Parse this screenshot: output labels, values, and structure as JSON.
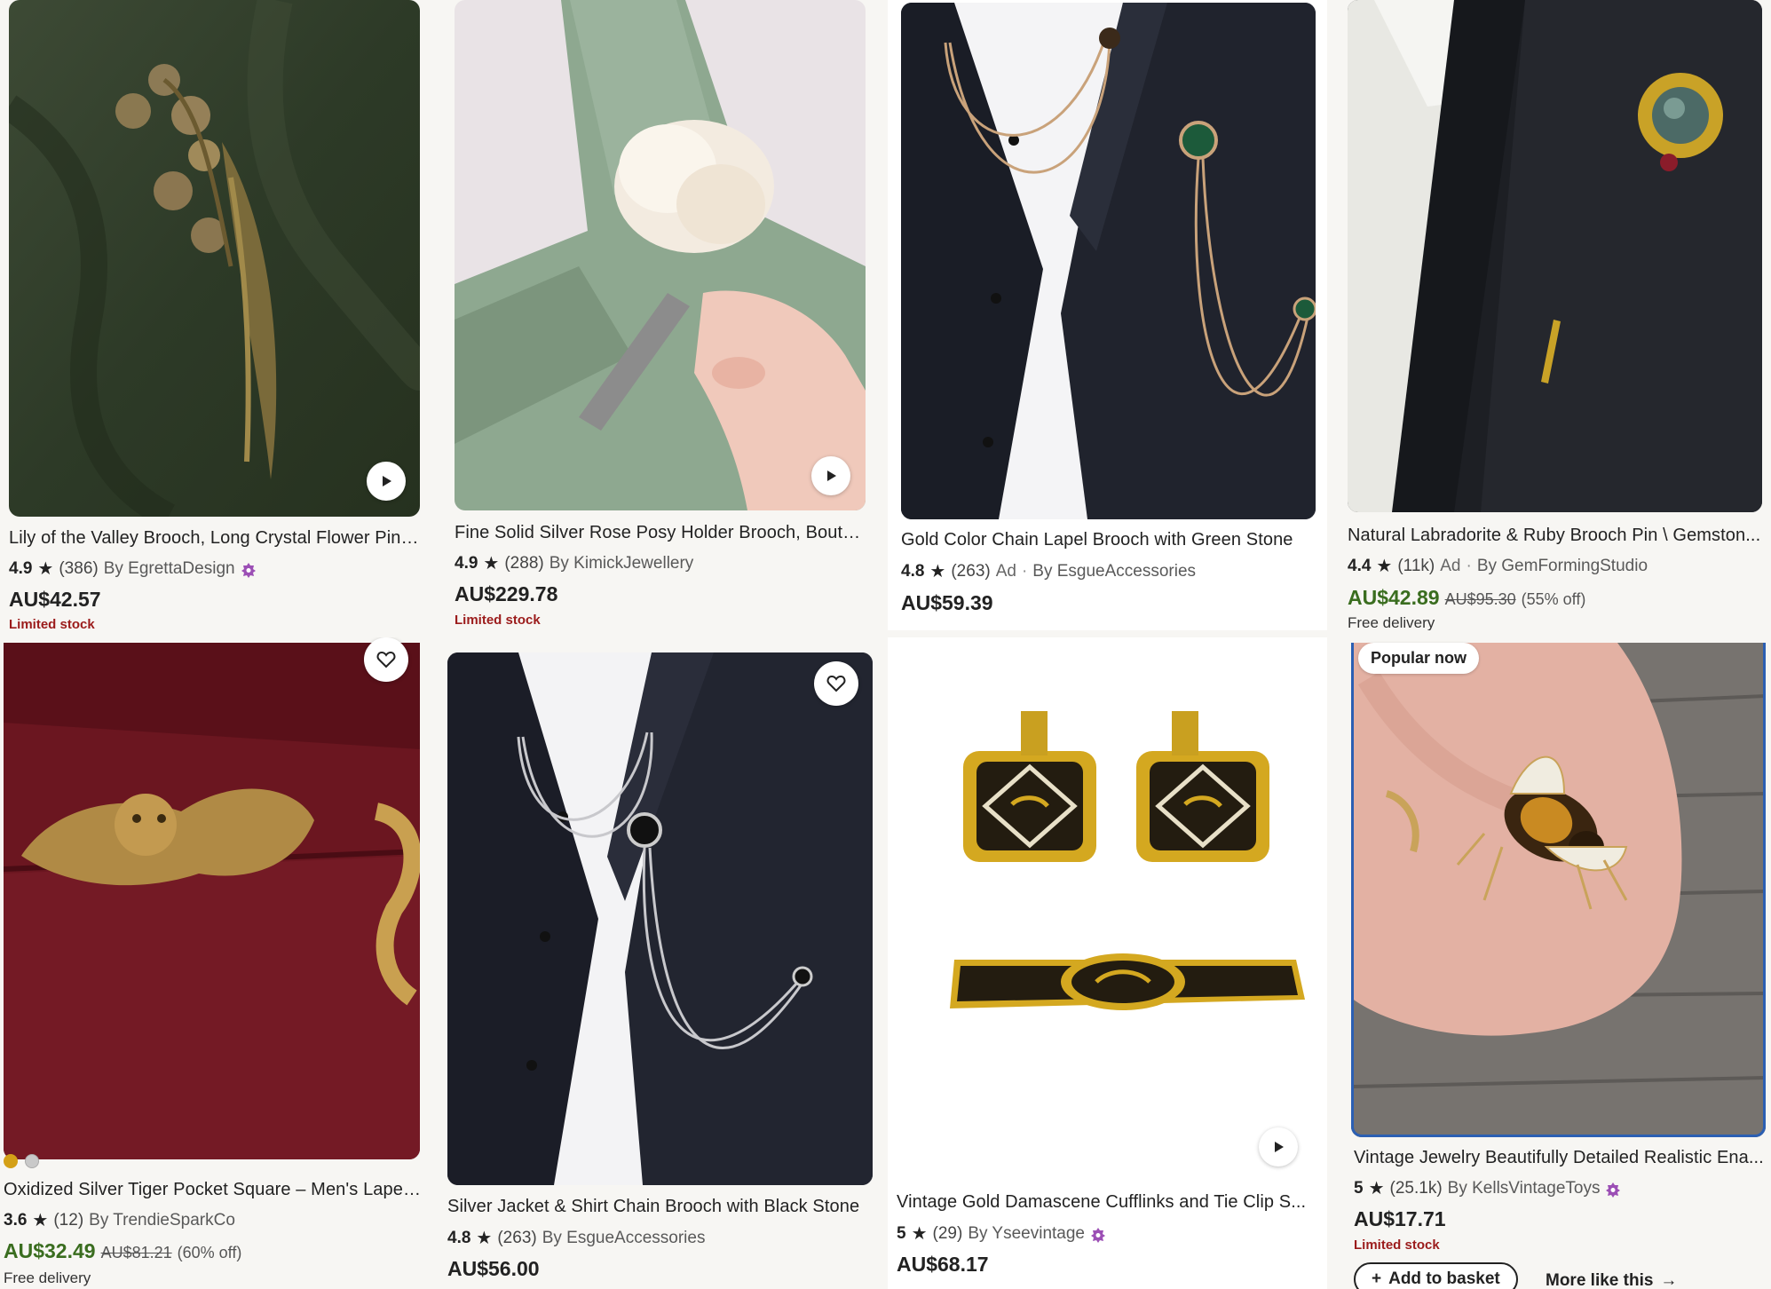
{
  "listings": [
    {
      "title": "Lily of the Valley Brooch, Long Crystal Flower Pin, ...",
      "rating": "4.9",
      "reviews": "(386)",
      "ad": "",
      "shop": "By EgrettaDesign",
      "star_seller": true,
      "price": "AU$42.57",
      "sale_price": "",
      "original_price": "",
      "discount": "",
      "note": "Limited stock",
      "delivery": "",
      "badge": "",
      "has_play": true,
      "has_fav": false
    },
    {
      "title": "Fine Solid Silver Rose Posy Holder Brooch, Bouton...",
      "rating": "4.9",
      "reviews": "(288)",
      "ad": "",
      "shop": "By KimickJewellery",
      "star_seller": false,
      "price": "AU$229.78",
      "sale_price": "",
      "original_price": "",
      "discount": "",
      "note": "Limited stock",
      "delivery": "",
      "badge": "",
      "has_play": true,
      "has_fav": false
    },
    {
      "title": "Gold Color Chain Lapel Brooch with Green Stone",
      "rating": "4.8",
      "reviews": "(263)",
      "ad": "Ad",
      "shop": "By EsgueAccessories",
      "star_seller": false,
      "price": "AU$59.39",
      "sale_price": "",
      "original_price": "",
      "discount": "",
      "note": "",
      "delivery": "",
      "badge": "",
      "has_play": false,
      "has_fav": false
    },
    {
      "title": "Natural Labradorite & Ruby Brooch Pin \\ Gemston...",
      "rating": "4.4",
      "reviews": "(11k)",
      "ad": "Ad",
      "shop": "By GemFormingStudio",
      "star_seller": false,
      "price": "",
      "sale_price": "AU$42.89",
      "original_price": "AU$95.30",
      "discount": "(55% off)",
      "note": "",
      "delivery": "Free delivery",
      "badge": "",
      "has_play": false,
      "has_fav": false
    },
    {
      "title": "Oxidized Silver Tiger Pocket Square – Men's Lapel...",
      "rating": "3.6",
      "reviews": "(12)",
      "ad": "",
      "shop": "By TrendieSparkCo",
      "star_seller": false,
      "price": "",
      "sale_price": "AU$32.49",
      "original_price": "AU$81.21",
      "discount": "(60% off)",
      "note": "",
      "delivery": "Free delivery",
      "badge": "",
      "has_play": false,
      "has_fav": true,
      "swatch_colors": [
        "#d4a017",
        "#c9c9c9"
      ]
    },
    {
      "title": "Silver Jacket & Shirt Chain Brooch with Black Stone",
      "rating": "4.8",
      "reviews": "(263)",
      "ad": "",
      "shop": "By EsgueAccessories",
      "star_seller": false,
      "price": "AU$56.00",
      "sale_price": "",
      "original_price": "",
      "discount": "",
      "note": "",
      "delivery": "",
      "badge": "",
      "has_play": false,
      "has_fav": true
    },
    {
      "title": "Vintage Gold Damascene Cufflinks and Tie Clip S...",
      "rating": "5",
      "reviews": "(29)",
      "ad": "",
      "shop": "By Yseevintage",
      "star_seller": true,
      "price": "AU$68.17",
      "sale_price": "",
      "original_price": "",
      "discount": "",
      "note": "",
      "delivery": "",
      "badge": "",
      "has_play": true,
      "has_fav": false
    },
    {
      "title": "Vintage Jewelry Beautifully Detailed Realistic Ena...",
      "rating": "5",
      "reviews": "(25.1k)",
      "ad": "",
      "shop": "By KellsVintageToys",
      "star_seller": true,
      "price": "AU$17.71",
      "sale_price": "",
      "original_price": "",
      "discount": "",
      "note": "Limited stock",
      "delivery": "",
      "badge": "Popular now",
      "has_play": false,
      "has_fav": false,
      "add_to_basket": "Add to basket",
      "more_like_this": "More like this"
    }
  ],
  "icons": {
    "star": "★",
    "plus": "+",
    "arrow": "→"
  },
  "colors": {
    "sale_green": "#3a6d1f",
    "limited_red": "#9b1b1b",
    "star_seller_purple": "#9c4fb5",
    "selected_blue": "#2b5fb3"
  }
}
